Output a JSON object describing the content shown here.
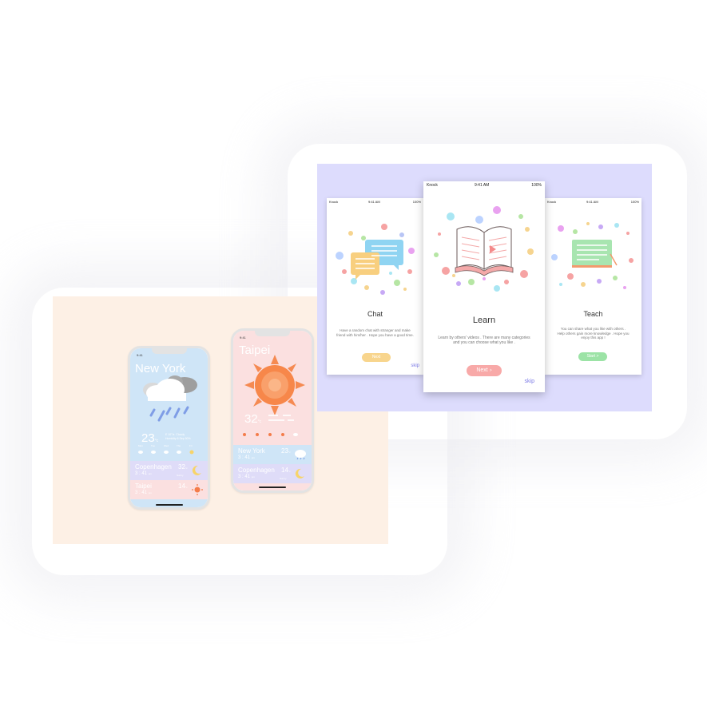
{
  "weather_app": {
    "phone_left": {
      "status_time": "9:41",
      "city": "New York",
      "temperature": "23",
      "unit": "°c",
      "details": [
        "E 10°/s",
        "Cloudy",
        "Humidity 6 Sep",
        "50%"
      ],
      "forecast_days": [
        "Mon",
        "Tue",
        "Wed",
        "Thu",
        "Fri"
      ],
      "other_cities": [
        {
          "name": "Copenhagen",
          "temp": "32",
          "unit": "°c",
          "time": "3 : 41",
          "ampm": "pm",
          "sub": "Sunny"
        },
        {
          "name": "Taipei",
          "temp": "14",
          "unit": "°c",
          "time": "3 : 41",
          "ampm": "pm"
        }
      ],
      "colors": {
        "top": "#cfe5f7",
        "row1": "#dfdcf8",
        "row2": "#fbe0e0"
      }
    },
    "phone_right": {
      "status_time": "9:41",
      "city": "Taipei",
      "temperature": "32",
      "unit": "°c",
      "other_cities": [
        {
          "name": "New York",
          "temp": "23",
          "unit": "°c",
          "time": "3 : 41",
          "ampm": "pm"
        },
        {
          "name": "Copenhagen",
          "temp": "14",
          "unit": "°c",
          "time": "3 : 41",
          "ampm": "pm",
          "sub": "Sunny"
        }
      ],
      "colors": {
        "top": "#fbe0e0",
        "row1": "#cfe5f7",
        "row2": "#dfdcf8"
      }
    }
  },
  "onboarding": {
    "status": {
      "carrier": "Knock",
      "time": "9:41 AM",
      "battery": "100%"
    },
    "screens": [
      {
        "title": "Chat",
        "body": [
          "Have a random chat with stranger and make",
          "friend with him/her . Hope you have a good time."
        ],
        "button": "Next",
        "skip": "skip",
        "button_color": "#f8d58d"
      },
      {
        "title": "Learn",
        "body": [
          "Learn by others' videos . There are many categories",
          "and you can choose what you like ."
        ],
        "button": "Next",
        "button_arrow": ">",
        "skip": "skip",
        "button_color": "#f8a9a8"
      },
      {
        "title": "Teach",
        "body": [
          "You can share what you like with others .",
          "Help others gain more knowledge . Hope you",
          "enjoy this app !"
        ],
        "button": "Start",
        "button_arrow": ">",
        "button_color": "#9ce3a6"
      }
    ]
  },
  "colors": {
    "peach_bg": "#fdf0e5",
    "lavender_bg": "#dddcfd",
    "accent_skip": "#7b79e6"
  }
}
